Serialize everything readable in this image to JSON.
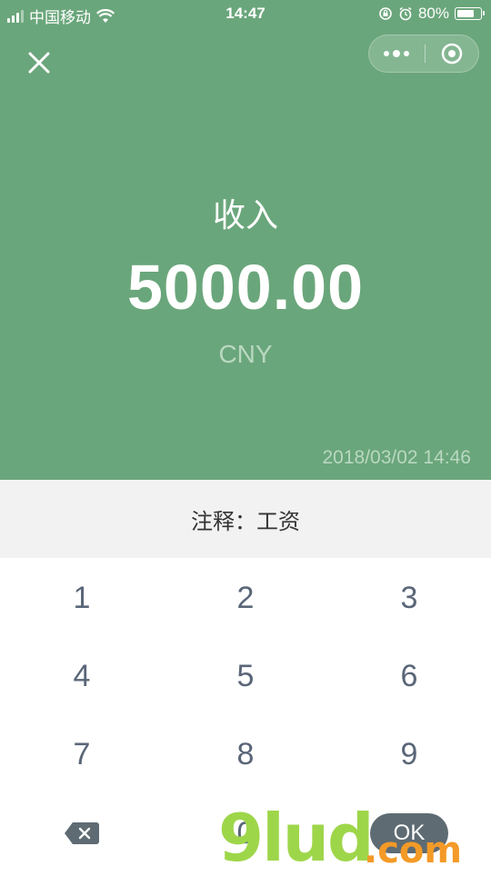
{
  "status_bar": {
    "carrier": "中国移动",
    "time": "14:47",
    "battery": "80%",
    "battery_level": 0.8,
    "icons": [
      "signal-icon",
      "wifi-icon",
      "rotation-lock-icon",
      "alarm-icon",
      "battery-icon"
    ]
  },
  "header": {
    "close_icon": "close-icon",
    "more_icon": "more-dots-icon",
    "target_icon": "target-icon"
  },
  "record": {
    "type_label": "收入",
    "amount": "5000.00",
    "currency": "CNY",
    "timestamp": "2018/03/02 14:46"
  },
  "note": {
    "text": "注释：工资"
  },
  "keypad": {
    "keys": [
      "1",
      "2",
      "3",
      "4",
      "5",
      "6",
      "7",
      "8",
      "9",
      "0"
    ],
    "backspace_icon": "backspace-icon",
    "ok_label": "OK"
  },
  "watermark": {
    "text": "9lud",
    "domain": ".com"
  },
  "colors": {
    "header_bg": "#6aa67b",
    "note_bg": "#f2f2f2",
    "key_text": "#5a6678",
    "ok_bg": "#5e6b73"
  }
}
